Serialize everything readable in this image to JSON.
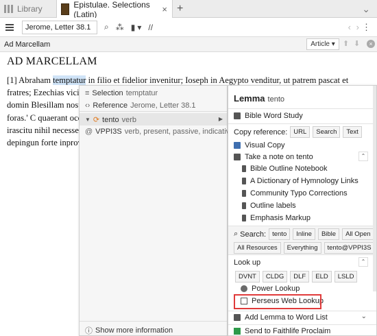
{
  "tabs": {
    "library_label": "Library",
    "active_label": "Epistulae. Selections (Latin)",
    "close_glyph": "×",
    "add_glyph": "+",
    "more_glyph": "⌄"
  },
  "toolbar": {
    "reference_value": "Jerome, Letter 38.1",
    "search_glyph": "⌕",
    "people_glyph": "⁂",
    "panel_glyph": "▮",
    "dropdown_glyph": "▾",
    "parallel_glyph": "//",
    "back_glyph": "‹",
    "forward_glyph": "›",
    "kebab_glyph": "⋮"
  },
  "titlebar": {
    "title": "Ad Marcellam",
    "article_label": "Article ▾",
    "up_glyph": "⬆",
    "down_glyph": "⬇",
    "close_glyph": "×"
  },
  "document": {
    "heading": "AD MARCELLAM",
    "para_before": "[1] Abraham ",
    "para_highlight": "temptatur",
    "para_after": " in filio et fidelior invenitur; Ioseph in Aegypto venditur, ut patrem pascat et fratres; Ezechias vici mortem, ut cantico per vitam; Petrus aposto lupus rapax et Benia circumdatus domin Blesillam nostram reiciendas delicias co tetigitque manum e conligata in saeculi 'Blesilla, exi foras.' C quaerant occidere su eius amplexare ped anhelos artus mors fumo? Nihil tibi deb gaudeat; qui irascitu nihil necesse habet quo inter natos mul qui camelorum ves locustis. Illae Chri oculosque depingun forte inprovidens lac quod vetulae sunt, c"
  },
  "left_popup": {
    "selection_label": "Selection",
    "selection_value": "temptatur",
    "reference_label": "Reference",
    "reference_value": "Jerome, Letter 38.1",
    "lemma_word": "tento",
    "lemma_pos": "verb",
    "morph_code": "VPPI3S",
    "morph_desc": "verb, present, passive, indicative, ",
    "show_more": "Show more information"
  },
  "right_popup": {
    "header_label": "Lemma",
    "header_word": "tento",
    "bible_word_study": "Bible Word Study",
    "copy_reference_label": "Copy reference:",
    "copy_buttons": [
      "URL",
      "Search",
      "Text"
    ],
    "visual_copy": "Visual Copy",
    "take_note": "Take a note on tento",
    "notebooks": [
      "Bible Outline Notebook",
      "A Dictionary of Hymnology Links",
      "Community Typo Corrections",
      "Outline labels",
      "Emphasis Markup"
    ],
    "search_label": "Search:",
    "search_buttons": [
      "tento",
      "Inline",
      "Bible",
      "All Open"
    ],
    "search_buttons_2": [
      "All Resources",
      "Everything",
      "tento@VPPI3S"
    ],
    "lookup_label": "Look up",
    "lookup_buttons": [
      "DVNT",
      "CLDG",
      "DLF",
      "ELD",
      "LSLD"
    ],
    "power_lookup": "Power Lookup",
    "perseus_lookup": "Perseus Web Lookup",
    "add_lemma": "Add Lemma to Word List",
    "send_proclaim": "Send to Faithlife Proclaim",
    "caret_up": "⌃",
    "caret_down": "⌄"
  }
}
